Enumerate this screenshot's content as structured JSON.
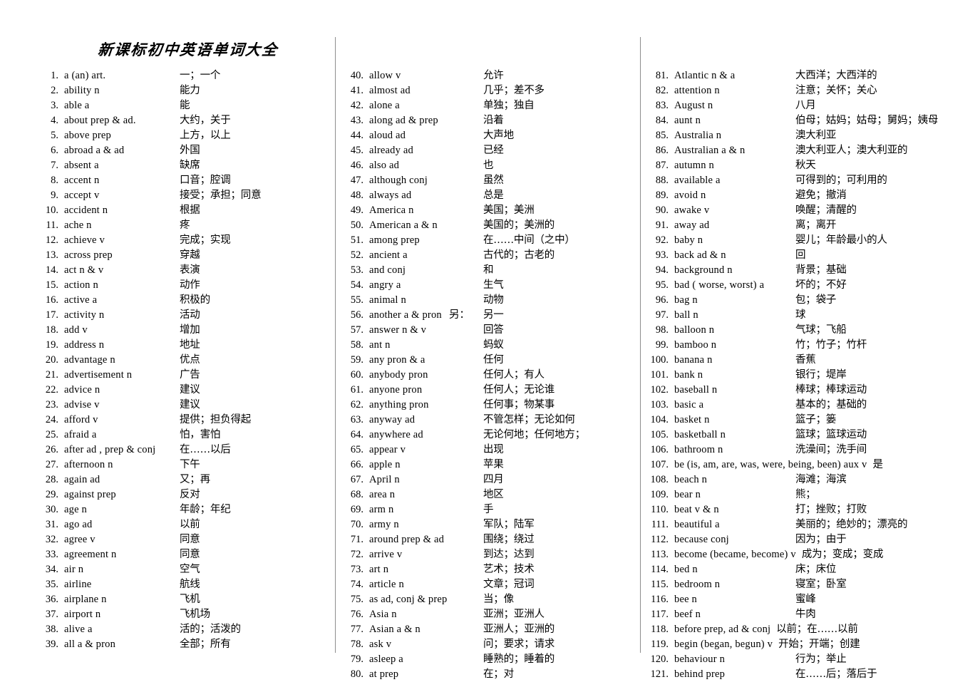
{
  "document": {
    "title": "新课标初中英语单词大全",
    "columns": [
      {
        "id": "column-1",
        "entries": [
          {
            "num": "1.",
            "term": "a (an)    art.",
            "gloss": "一；一个"
          },
          {
            "num": "2.",
            "term": "ability    n",
            "gloss": "能力"
          },
          {
            "num": "3.",
            "term": "able     a",
            "gloss": "能"
          },
          {
            "num": "4.",
            "term": "about   prep  &   ad.",
            "gloss": "大约，关于"
          },
          {
            "num": "5.",
            "term": "above   prep",
            "gloss": "上方，以上"
          },
          {
            "num": "6.",
            "term": "abroad   a  &   ad",
            "gloss": "外国"
          },
          {
            "num": "7.",
            "term": "absent   a",
            "gloss": "缺席"
          },
          {
            "num": "8.",
            "term": "accent    n",
            "gloss": "口音；腔调"
          },
          {
            "num": "9.",
            "term": "accept   v",
            "gloss": "接受；承担；同意"
          },
          {
            "num": "10.",
            "term": "accident   n",
            "gloss": "根据"
          },
          {
            "num": "11.",
            "term": "ache   n",
            "gloss": "疼"
          },
          {
            "num": "12.",
            "term": "achieve    v",
            "gloss": "完成；实现"
          },
          {
            "num": "13.",
            "term": "across   prep",
            "gloss": "穿越"
          },
          {
            "num": "14.",
            "term": "act     n  &   v",
            "gloss": "表演"
          },
          {
            "num": "15.",
            "term": "action     n",
            "gloss": "动作"
          },
          {
            "num": "16.",
            "term": "active     a",
            "gloss": "积极的"
          },
          {
            "num": "17.",
            "term": "activity    n",
            "gloss": "活动"
          },
          {
            "num": "18.",
            "term": "add    v",
            "gloss": "增加"
          },
          {
            "num": "19.",
            "term": "address    n",
            "gloss": "地址"
          },
          {
            "num": "20.",
            "term": "advantage   n",
            "gloss": "优点"
          },
          {
            "num": "21.",
            "term": "advertisement   n",
            "gloss": "广告"
          },
          {
            "num": "22.",
            "term": "advice    n",
            "gloss": "建议"
          },
          {
            "num": "23.",
            "term": "advise    v",
            "gloss": "建议"
          },
          {
            "num": "24.",
            "term": "afford   v",
            "gloss": "提供；担负得起"
          },
          {
            "num": "25.",
            "term": "afraid    a",
            "gloss": "怕，害怕"
          },
          {
            "num": "26.",
            "term": "after   ad ,   prep   & conj",
            "gloss": "在……以后"
          },
          {
            "num": "27.",
            "term": "afternoon    n",
            "gloss": "下午"
          },
          {
            "num": "28.",
            "term": "again    ad",
            "gloss": "又；再"
          },
          {
            "num": "29.",
            "term": "against   prep",
            "gloss": "反对"
          },
          {
            "num": "30.",
            "term": "age    n",
            "gloss": "年龄；年纪"
          },
          {
            "num": "31.",
            "term": "ago    ad",
            "gloss": "以前"
          },
          {
            "num": "32.",
            "term": "agree     v",
            "gloss": "同意"
          },
          {
            "num": "33.",
            "term": "agreement   n",
            "gloss": "同意"
          },
          {
            "num": "34.",
            "term": "air    n",
            "gloss": "空气"
          },
          {
            "num": "35.",
            "term": "airline",
            "gloss": "航线"
          },
          {
            "num": "36.",
            "term": "airplane   n",
            "gloss": "飞机"
          },
          {
            "num": "37.",
            "term": "airport   n",
            "gloss": "飞机场"
          },
          {
            "num": "38.",
            "term": "alive   a",
            "gloss": "活的；活泼的"
          },
          {
            "num": "39.",
            "term": "all      a  &   pron",
            "gloss": "全部；所有"
          }
        ]
      },
      {
        "id": "column-2",
        "entries": [
          {
            "num": "40.",
            "term": "allow   v",
            "gloss": "允许"
          },
          {
            "num": "41.",
            "term": "almost    ad",
            "gloss": "几乎；差不多"
          },
          {
            "num": "42.",
            "term": "alone    a",
            "gloss": "单独；独自"
          },
          {
            "num": "43.",
            "term": "along   ad  &   prep",
            "gloss": "沿着"
          },
          {
            "num": "44.",
            "term": "aloud    ad",
            "gloss": "大声地"
          },
          {
            "num": "45.",
            "term": "already   ad",
            "gloss": "已经"
          },
          {
            "num": "46.",
            "term": "also    ad",
            "gloss": "也"
          },
          {
            "num": "47.",
            "term": "although   conj",
            "gloss": "虽然"
          },
          {
            "num": "48.",
            "term": "always   ad",
            "gloss": "总是"
          },
          {
            "num": "49.",
            "term": "America    n",
            "gloss": "美国；美洲"
          },
          {
            "num": "50.",
            "term": "American  a  &  n",
            "gloss": "美国的；美洲的"
          },
          {
            "num": "51.",
            "term": "among   prep",
            "gloss": "在……中间（之中）"
          },
          {
            "num": "52.",
            "term": "ancient    a",
            "gloss": "古代的；古老的"
          },
          {
            "num": "53.",
            "term": "and   conj",
            "gloss": "和"
          },
          {
            "num": "54.",
            "term": "angry   a",
            "gloss": "生气"
          },
          {
            "num": "55.",
            "term": "animal    n",
            "gloss": "动物"
          },
          {
            "num": "56.",
            "term": "another   a & pron",
            "midfrag": "另：",
            "gloss": "另一"
          },
          {
            "num": "57.",
            "term": "answer    n  &   v",
            "gloss": "回答"
          },
          {
            "num": "58.",
            "term": "ant   n",
            "gloss": "蚂蚁"
          },
          {
            "num": "59.",
            "term": "any    pron  &    a",
            "gloss": "任何"
          },
          {
            "num": "60.",
            "term": "anybody    pron",
            "gloss": "任何人；有人"
          },
          {
            "num": "61.",
            "term": "anyone    pron",
            "gloss": "任何人；无论谁"
          },
          {
            "num": "62.",
            "term": "anything     pron",
            "gloss": "任何事；物某事"
          },
          {
            "num": "63.",
            "term": "anyway   ad",
            "gloss": "不管怎样；无论如何"
          },
          {
            "num": "64.",
            "term": "anywhere   ad",
            "gloss": "无论何地；任何地方；"
          },
          {
            "num": "65.",
            "term": "appear   v",
            "gloss": "出现"
          },
          {
            "num": "66.",
            "term": "apple    n",
            "gloss": "苹果"
          },
          {
            "num": "67.",
            "term": "April   n",
            "gloss": "四月"
          },
          {
            "num": "68.",
            "term": "area    n",
            "gloss": "地区"
          },
          {
            "num": "69.",
            "term": "arm    n",
            "gloss": "手"
          },
          {
            "num": "70.",
            "term": "army   n",
            "gloss": "军队；陆军"
          },
          {
            "num": "71.",
            "term": "around   prep  &  ad",
            "gloss": "围绕；绕过"
          },
          {
            "num": "72.",
            "term": "arrive    v",
            "gloss": "到达；达到"
          },
          {
            "num": "73.",
            "term": "art   n",
            "gloss": "艺术；技术"
          },
          {
            "num": "74.",
            "term": "article    n",
            "gloss": "文章；冠词"
          },
          {
            "num": "75.",
            "term": "as    ad,   conj   &   prep",
            "gloss": "当；像"
          },
          {
            "num": "76.",
            "term": "Asia     n",
            "gloss": "亚洲；亚洲人"
          },
          {
            "num": "77.",
            "term": "Asian    a   &   n",
            "gloss": "亚洲人；亚洲的"
          },
          {
            "num": "78.",
            "term": "ask    v",
            "gloss": "问；要求；请求"
          },
          {
            "num": "79.",
            "term": "asleep   a",
            "gloss": "睡熟的；睡着的"
          },
          {
            "num": "80.",
            "term": "at    prep",
            "gloss": "在；对"
          }
        ]
      },
      {
        "id": "column-3",
        "entries": [
          {
            "num": "81.",
            "term": "Atlantic   n  &   a",
            "gloss": "大西洋；大西洋的"
          },
          {
            "num": "82.",
            "term": "attention    n",
            "gloss": "注意；关怀；关心"
          },
          {
            "num": "83.",
            "term": "August   n",
            "gloss": "八月"
          },
          {
            "num": "84.",
            "term": "aunt     n",
            "gloss": "伯母；姑妈；姑母；舅妈；姨母"
          },
          {
            "num": "85.",
            "term": "Australia   n",
            "gloss": "澳大利亚"
          },
          {
            "num": "86.",
            "term": "Australian    a   &   n",
            "gloss": "澳大利亚人；澳大利亚的"
          },
          {
            "num": "87.",
            "term": "autumn      n",
            "gloss": "秋天"
          },
          {
            "num": "88.",
            "term": "available   a",
            "gloss": "可得到的；可利用的"
          },
          {
            "num": "89.",
            "term": "avoid   n",
            "gloss": "避免；撤消"
          },
          {
            "num": "90.",
            "term": "awake   v",
            "gloss": "唤醒；清醒的"
          },
          {
            "num": "91.",
            "term": "away    ad",
            "gloss": "离；离开"
          },
          {
            "num": "92.",
            "term": "baby    n",
            "gloss": "婴儿；年龄最小的人"
          },
          {
            "num": "93.",
            "term": "back   ad  &   n",
            "gloss": "回"
          },
          {
            "num": "94.",
            "term": "background   n",
            "gloss": "背景；基础"
          },
          {
            "num": "95.",
            "term": "bad ( worse,   worst)    a",
            "gloss": "坏的；不好"
          },
          {
            "num": "96.",
            "term": "bag   n",
            "gloss": "包；袋子"
          },
          {
            "num": "97.",
            "term": "ball   n",
            "gloss": "球"
          },
          {
            "num": "98.",
            "term": "balloon   n",
            "gloss": "气球；飞船"
          },
          {
            "num": "99.",
            "term": "bamboo    n",
            "gloss": "竹；竹子；竹杆"
          },
          {
            "num": "100.",
            "term": "banana      n",
            "gloss": "香蕉"
          },
          {
            "num": "101.",
            "term": "bank    n",
            "gloss": "银行；堤岸"
          },
          {
            "num": "102.",
            "term": "baseball    n",
            "gloss": "棒球；棒球运动"
          },
          {
            "num": "103.",
            "term": "basic    a",
            "gloss": "基本的；基础的"
          },
          {
            "num": "104.",
            "term": "basket      n",
            "gloss": "篮子；篓"
          },
          {
            "num": "105.",
            "term": "basketball    n",
            "gloss": "篮球；篮球运动"
          },
          {
            "num": "106.",
            "term": "bathroom      n",
            "gloss": "洗澡间；洗手间"
          },
          {
            "num": "107.",
            "term": "be (is, am, are, was, were, being, been)   aux v",
            "gloss": "是",
            "wide": true
          },
          {
            "num": "108.",
            "term": "beach   n",
            "gloss": "海滩；海滨"
          },
          {
            "num": "109.",
            "term": "bear     n",
            "gloss": "熊；"
          },
          {
            "num": "110.",
            "term": "beat     v   &   n",
            "gloss": "打；挫败；打败"
          },
          {
            "num": "111.",
            "term": "beautiful    a",
            "gloss": "美丽的；绝妙的；漂亮的"
          },
          {
            "num": "112.",
            "term": "because   conj",
            "gloss": "因为；由于"
          },
          {
            "num": "113.",
            "term": "become (became, become)   v",
            "gloss": "成为；变成；变成",
            "wide": true
          },
          {
            "num": "114.",
            "term": "bed   n",
            "gloss": "床；床位"
          },
          {
            "num": "115.",
            "term": "bedroom     n",
            "gloss": "寝室；卧室"
          },
          {
            "num": "116.",
            "term": "bee   n",
            "gloss": "蜜峰"
          },
          {
            "num": "117.",
            "term": "beef   n",
            "gloss": "牛肉"
          },
          {
            "num": "118.",
            "term": "before    prep,   ad   &   conj",
            "gloss": "以前；在……以前",
            "wide": true
          },
          {
            "num": "119.",
            "term": "begin (began, begun)     v",
            "gloss": "开始；开端；创建",
            "wide": true
          },
          {
            "num": "120.",
            "term": "behaviour     n",
            "gloss": "行为；举止"
          },
          {
            "num": "121.",
            "term": "behind   prep",
            "gloss": "在……后；落后于"
          }
        ]
      }
    ]
  }
}
